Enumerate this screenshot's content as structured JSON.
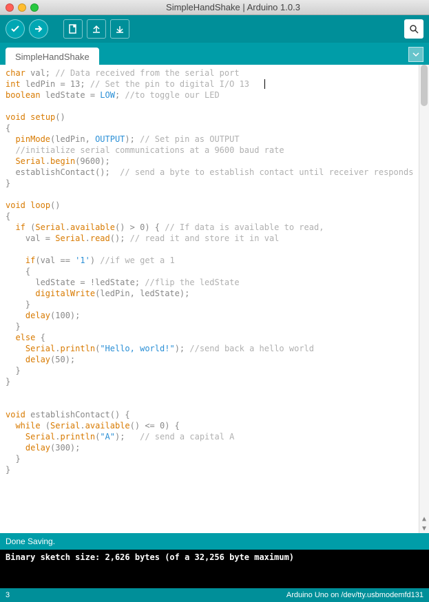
{
  "window": {
    "title": "SimpleHandShake | Arduino 1.0.3"
  },
  "tab": {
    "label": "SimpleHandShake"
  },
  "status": {
    "text": "Done Saving."
  },
  "console": {
    "text": "Binary sketch size: 2,626 bytes (of a 32,256 byte maximum)"
  },
  "footer": {
    "line": "3",
    "board": "Arduino Uno on /dev/tty.usbmodemfd131"
  },
  "code": {
    "tokens": [
      [
        [
          "kw",
          "char"
        ],
        [
          "norm",
          " val; "
        ],
        [
          "cmt",
          "// Data received from the serial port"
        ]
      ],
      [
        [
          "kw",
          "int"
        ],
        [
          "norm",
          " ledPin = 13; "
        ],
        [
          "cmt",
          "// Set the pin to digital I/O 13"
        ]
      ],
      [
        [
          "kw",
          "boolean"
        ],
        [
          "norm",
          " ledState = "
        ],
        [
          "const",
          "LOW"
        ],
        [
          "norm",
          "; "
        ],
        [
          "cmt",
          "//to toggle our LED"
        ]
      ],
      [],
      [
        [
          "kw",
          "void"
        ],
        [
          "norm",
          " "
        ],
        [
          "fn",
          "setup"
        ],
        [
          "norm",
          "()"
        ]
      ],
      [
        [
          "norm",
          "{"
        ]
      ],
      [
        [
          "norm",
          "  "
        ],
        [
          "fn",
          "pinMode"
        ],
        [
          "norm",
          "(ledPin, "
        ],
        [
          "const",
          "OUTPUT"
        ],
        [
          "norm",
          "); "
        ],
        [
          "cmt",
          "// Set pin as OUTPUT"
        ]
      ],
      [
        [
          "norm",
          "  "
        ],
        [
          "cmt",
          "//initialize serial communications at a 9600 baud rate"
        ]
      ],
      [
        [
          "norm",
          "  "
        ],
        [
          "fn",
          "Serial"
        ],
        [
          "norm",
          "."
        ],
        [
          "fn",
          "begin"
        ],
        [
          "norm",
          "(9600);"
        ]
      ],
      [
        [
          "norm",
          "  establishContact();  "
        ],
        [
          "cmt",
          "// send a byte to establish contact until receiver responds"
        ]
      ],
      [
        [
          "norm",
          "}"
        ]
      ],
      [],
      [
        [
          "kw",
          "void"
        ],
        [
          "norm",
          " "
        ],
        [
          "fn",
          "loop"
        ],
        [
          "norm",
          "()"
        ]
      ],
      [
        [
          "norm",
          "{"
        ]
      ],
      [
        [
          "norm",
          "  "
        ],
        [
          "kw",
          "if"
        ],
        [
          "norm",
          " ("
        ],
        [
          "fn",
          "Serial"
        ],
        [
          "norm",
          "."
        ],
        [
          "fn",
          "available"
        ],
        [
          "norm",
          "() > 0) { "
        ],
        [
          "cmt",
          "// If data is available to read,"
        ]
      ],
      [
        [
          "norm",
          "    val = "
        ],
        [
          "fn",
          "Serial"
        ],
        [
          "norm",
          "."
        ],
        [
          "fn",
          "read"
        ],
        [
          "norm",
          "(); "
        ],
        [
          "cmt",
          "// read it and store it in val"
        ]
      ],
      [],
      [
        [
          "norm",
          "    "
        ],
        [
          "kw",
          "if"
        ],
        [
          "norm",
          "(val == "
        ],
        [
          "str",
          "'1'"
        ],
        [
          "norm",
          ") "
        ],
        [
          "cmt",
          "//if we get a 1"
        ]
      ],
      [
        [
          "norm",
          "    {"
        ]
      ],
      [
        [
          "norm",
          "      ledState = !ledState; "
        ],
        [
          "cmt",
          "//flip the ledState"
        ]
      ],
      [
        [
          "norm",
          "      "
        ],
        [
          "fn",
          "digitalWrite"
        ],
        [
          "norm",
          "(ledPin, ledState);"
        ]
      ],
      [
        [
          "norm",
          "    }"
        ]
      ],
      [
        [
          "norm",
          "    "
        ],
        [
          "fn",
          "delay"
        ],
        [
          "norm",
          "(100);"
        ]
      ],
      [
        [
          "norm",
          "  }"
        ]
      ],
      [
        [
          "norm",
          "  "
        ],
        [
          "kw",
          "else"
        ],
        [
          "norm",
          " {"
        ]
      ],
      [
        [
          "norm",
          "    "
        ],
        [
          "fn",
          "Serial"
        ],
        [
          "norm",
          "."
        ],
        [
          "fn",
          "println"
        ],
        [
          "norm",
          "("
        ],
        [
          "str",
          "\"Hello, world!\""
        ],
        [
          "norm",
          "); "
        ],
        [
          "cmt",
          "//send back a hello world"
        ]
      ],
      [
        [
          "norm",
          "    "
        ],
        [
          "fn",
          "delay"
        ],
        [
          "norm",
          "(50);"
        ]
      ],
      [
        [
          "norm",
          "  }"
        ]
      ],
      [
        [
          "norm",
          "}"
        ]
      ],
      [],
      [],
      [
        [
          "kw",
          "void"
        ],
        [
          "norm",
          " establishContact() {"
        ]
      ],
      [
        [
          "norm",
          "  "
        ],
        [
          "kw",
          "while"
        ],
        [
          "norm",
          " ("
        ],
        [
          "fn",
          "Serial"
        ],
        [
          "norm",
          "."
        ],
        [
          "fn",
          "available"
        ],
        [
          "norm",
          "() <= 0) {"
        ]
      ],
      [
        [
          "norm",
          "    "
        ],
        [
          "fn",
          "Serial"
        ],
        [
          "norm",
          "."
        ],
        [
          "fn",
          "println"
        ],
        [
          "norm",
          "("
        ],
        [
          "str",
          "\"A\""
        ],
        [
          "norm",
          ");   "
        ],
        [
          "cmt",
          "// send a capital A"
        ]
      ],
      [
        [
          "norm",
          "    "
        ],
        [
          "fn",
          "delay"
        ],
        [
          "norm",
          "(300);"
        ]
      ],
      [
        [
          "norm",
          "  }"
        ]
      ],
      [
        [
          "norm",
          "}"
        ]
      ]
    ],
    "cursor_line": 1
  }
}
